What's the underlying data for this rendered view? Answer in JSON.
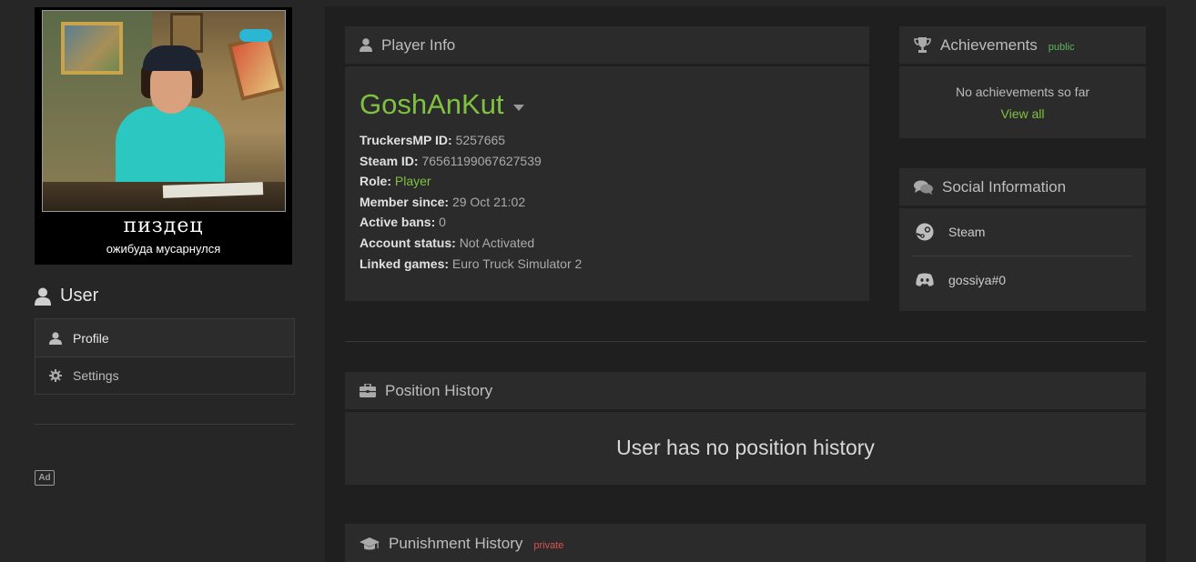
{
  "avatar": {
    "caption_title": "пиздец",
    "caption_sub": "ожибуда мусарнулся"
  },
  "sidebar": {
    "heading": "User",
    "items": [
      {
        "label": "Profile",
        "icon": "user-icon",
        "active": true
      },
      {
        "label": "Settings",
        "icon": "gear-icon",
        "active": false
      }
    ],
    "ad_label": "Ad"
  },
  "player_info": {
    "title": "Player Info",
    "username": "GoshAnKut",
    "rows": [
      {
        "label": "TruckersMP ID:",
        "value": "5257665"
      },
      {
        "label": "Steam ID:",
        "value": "76561199067627539"
      },
      {
        "label": "Role:",
        "value": "Player"
      },
      {
        "label": "Member since:",
        "value": "29 Oct 21:02"
      },
      {
        "label": "Active bans:",
        "value": "0"
      },
      {
        "label": "Account status:",
        "value": "Not Activated"
      },
      {
        "label": "Linked games:",
        "value": "Euro Truck Simulator 2"
      }
    ]
  },
  "achievements": {
    "title": "Achievements",
    "visibility": "public",
    "empty_text": "No achievements so far",
    "view_all": "View all"
  },
  "social": {
    "title": "Social Information",
    "items": [
      {
        "label": "Steam",
        "icon": "steam-icon"
      },
      {
        "label": "gossiya#0",
        "icon": "discord-icon"
      }
    ]
  },
  "position_history": {
    "title": "Position History",
    "empty_text": "User has no position history"
  },
  "punishment_history": {
    "title": "Punishment History",
    "visibility": "private"
  },
  "colors": {
    "accent_green": "#7fc241",
    "private_red": "#d9534f",
    "panel_bg": "#2b2b2b",
    "page_bg": "#262626"
  }
}
